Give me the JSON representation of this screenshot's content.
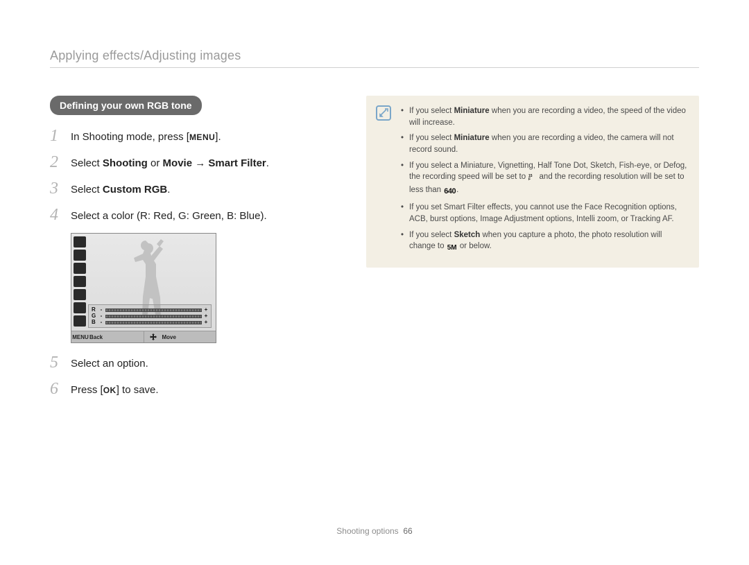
{
  "header": {
    "section_title": "Applying effects/Adjusting images"
  },
  "pill": {
    "label": "Defining your own RGB tone"
  },
  "steps": [
    {
      "num": "1",
      "pre": "In Shooting mode, press [",
      "kbd": "MENU",
      "post": "]."
    },
    {
      "num": "2",
      "html_parts": [
        "Select ",
        "Shooting",
        " or ",
        "Movie",
        " → ",
        "Smart Filter",
        "."
      ]
    },
    {
      "num": "3",
      "html_parts": [
        "Select ",
        "Custom RGB",
        "."
      ]
    },
    {
      "num": "4",
      "text": "Select a color (R: Red, G: Green, B: Blue)."
    },
    {
      "num": "5",
      "text": "Select an option."
    },
    {
      "num": "6",
      "pre": "Press [",
      "kbd": "OK",
      "post": "] to save."
    }
  ],
  "shot": {
    "rgb_labels": [
      "R",
      "G",
      "B"
    ],
    "back_kbd": "MENU",
    "back_label": "Back",
    "move_label": "Move"
  },
  "note": {
    "items": [
      {
        "parts": [
          "If you select ",
          {
            "b": "Miniature"
          },
          " when you are recording a video, the speed of the video will increase."
        ]
      },
      {
        "parts": [
          "If you select ",
          {
            "b": "Miniature"
          },
          " when you are recording a video, the camera will not record sound."
        ]
      },
      {
        "parts": [
          "If you select a Miniature, Vignetting, Half Tone Dot, Sketch, Fish-eye, or Defog, the recording speed will be set to ",
          {
            "icon": "fps15"
          },
          " and the recording resolution will be set to less than ",
          {
            "icon": "640"
          },
          "."
        ]
      },
      {
        "parts": [
          "If you set Smart Filter effects, you cannot use the Face Recognition options, ACB, burst options, Image Adjustment options, Intelli zoom, or Tracking AF."
        ]
      },
      {
        "parts": [
          "If you select ",
          {
            "b": "Sketch"
          },
          " when you capture a photo, the photo resolution will change to ",
          {
            "icon": "5m"
          },
          " or below."
        ]
      }
    ]
  },
  "footer": {
    "label": "Shooting options",
    "page": "66"
  }
}
